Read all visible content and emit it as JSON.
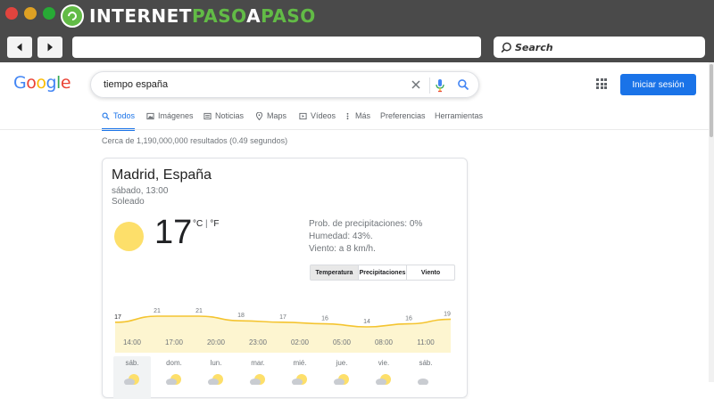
{
  "window": {
    "brand": {
      "part1": "INTERNET",
      "part2": "PASO",
      "part3": "A",
      "part4": "PASO"
    },
    "search_placeholder": "Search"
  },
  "google": {
    "logo": [
      "G",
      "o",
      "o",
      "g",
      "l",
      "e"
    ],
    "query": "tiempo españa",
    "signin_label": "Iniciar sesión",
    "tabs": [
      {
        "label": "Todos",
        "icon": "search-icon",
        "active": true
      },
      {
        "label": "Imágenes",
        "icon": "image-icon"
      },
      {
        "label": "Noticias",
        "icon": "news-icon"
      },
      {
        "label": "Maps",
        "icon": "map-pin-icon"
      },
      {
        "label": "Vídeos",
        "icon": "video-icon"
      },
      {
        "label": "Más",
        "icon": "more-icon"
      },
      {
        "label": "Preferencias"
      },
      {
        "label": "Herramientas"
      }
    ],
    "result_stats": "Cerca de 1,190,000,000 resultados (0.49 segundos)"
  },
  "weather": {
    "location": "Madrid, España",
    "datetime": "sábado, 13:00",
    "condition": "Soleado",
    "temperature": "17",
    "unit_c": "°C",
    "unit_sep": " | ",
    "unit_f": "°F",
    "precipitation": "Prob. de precipitaciones: 0%",
    "humidity": "Humedad: 43%.",
    "wind": "Viento: a 8 km/h.",
    "segments": [
      "Temperatura",
      "Precipitaciones",
      "Viento"
    ],
    "selected_segment": "Temperatura",
    "days": [
      "sáb.",
      "dom.",
      "lun.",
      "mar.",
      "mié.",
      "jue.",
      "vie.",
      "sáb."
    ],
    "colors": {
      "fill": "#fdf5d0",
      "line": "#f4c430",
      "sun": "#fddf6a"
    }
  },
  "chart_data": {
    "type": "area",
    "x": [
      "14:00",
      "17:00",
      "20:00",
      "23:00",
      "02:00",
      "05:00",
      "08:00",
      "11:00"
    ],
    "values": [
      17,
      21,
      21,
      18,
      17,
      16,
      14,
      16,
      19
    ],
    "point_labels": [
      "17",
      "21",
      "21",
      "18",
      "17",
      "16",
      "14",
      "16",
      "19"
    ],
    "xlabel": "",
    "ylabel": "",
    "ylim": [
      0,
      25
    ],
    "grid": false
  }
}
